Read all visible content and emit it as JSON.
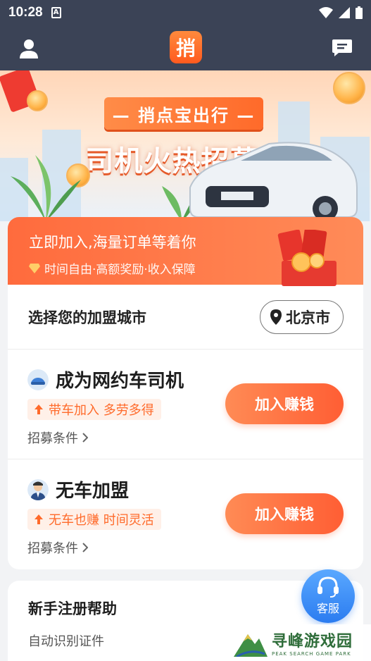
{
  "status_bar": {
    "time": "10:28",
    "indicator": "A"
  },
  "top_nav": {
    "logo_char": "捎",
    "icons": [
      "user-icon",
      "message-icon"
    ]
  },
  "banner": {
    "title": "— 捎点宝出行 —",
    "headline": "司机火热招募中"
  },
  "promo": {
    "line1": "立即加入,海量订单等着你",
    "line2": "时间自由·高额奖励·收入保障"
  },
  "city": {
    "label": "选择您的加盟城市",
    "selected": "北京市"
  },
  "options": [
    {
      "title": "成为网约车司机",
      "tag": "带车加入 多劳多得",
      "conditions": "招募条件",
      "button": "加入赚钱"
    },
    {
      "title": "无车加盟",
      "tag": "无车也赚 时间灵活",
      "conditions": "招募条件",
      "button": "加入赚钱"
    }
  ],
  "help": {
    "title": "新手注册帮助",
    "subtitle": "自动识别证件"
  },
  "customer_service": {
    "label": "客服"
  },
  "watermark": {
    "cn": "寻峰游戏园",
    "en": "PEAK SEARCH GAME PARK"
  },
  "colors": {
    "accent": "#ff6a2a",
    "nav_bg": "#3b4356",
    "cs_blue": "#2b7cf0"
  }
}
